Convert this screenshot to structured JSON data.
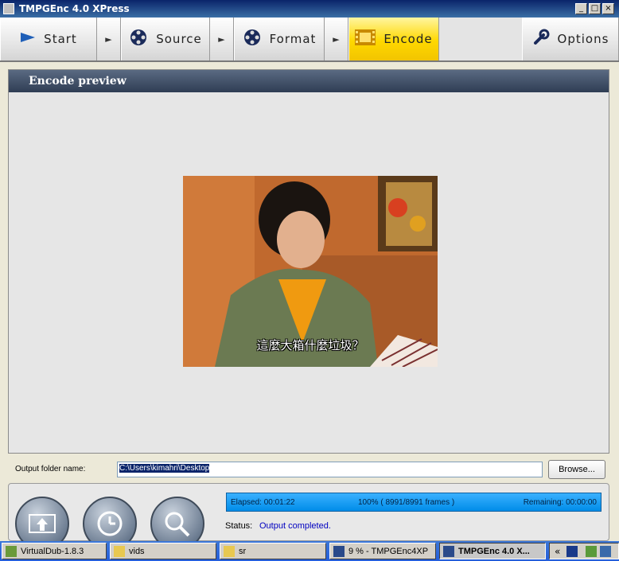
{
  "window": {
    "title": "TMPGEnc 4.0 XPress",
    "controls": [
      "_",
      "□",
      "×"
    ]
  },
  "toolbar": {
    "start": "Start",
    "source": "Source",
    "format": "Format",
    "encode": "Encode",
    "options": "Options",
    "arrow": "►",
    "active_color": "#ffd800"
  },
  "main": {
    "section_title": "Encode preview",
    "preview_subtitle": "這麼大箱什麼垃圾？"
  },
  "output": {
    "label": "Output folder name:",
    "path": "C:\\Users\\kimahri\\Desktop",
    "browse_label": "Browse..."
  },
  "progress": {
    "elapsed": "Elapsed: 00:01:22",
    "percent": "100% ( 8991/8991  frames )",
    "remaining": "Remaining: 00:00:00",
    "fraction": 1.0
  },
  "status": {
    "label": "Status:",
    "value": "Output completed."
  },
  "taskbar": {
    "items": [
      {
        "label": "VirtualDub-1.8.3",
        "icon": "virtualdub-icon"
      },
      {
        "label": "vids",
        "icon": "folder-icon"
      },
      {
        "label": "sr",
        "icon": "folder-icon"
      },
      {
        "label": "9 % - TMPGEnc4XP",
        "icon": "film-icon"
      },
      {
        "label": "TMPGEnc 4.0 X...",
        "icon": "film-icon"
      }
    ],
    "tray_chevron": "«"
  }
}
